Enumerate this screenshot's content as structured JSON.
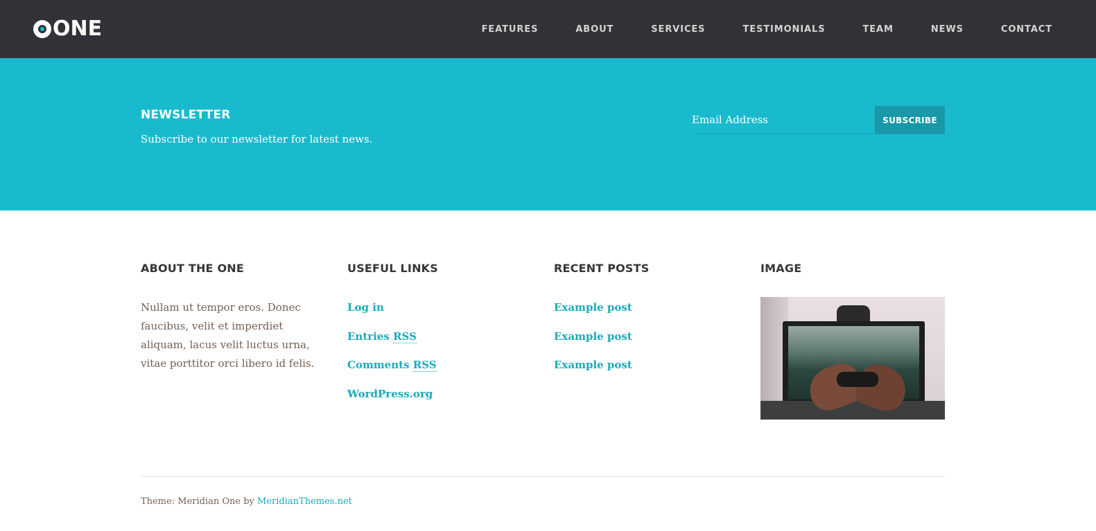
{
  "header": {
    "logo_text": "ONE",
    "nav": [
      "FEATURES",
      "ABOUT",
      "SERVICES",
      "TESTIMONIALS",
      "TEAM",
      "NEWS",
      "CONTACT"
    ]
  },
  "newsletter": {
    "title": "NEWSLETTER",
    "text": "Subscribe to our newsletter for latest news.",
    "email_placeholder": "Email Address",
    "button_label": "SUBSCRIBE"
  },
  "widgets": {
    "about": {
      "title": "ABOUT THE ONE",
      "text": "Nullam ut tempor eros. Donec faucibus, velit et imperdiet aliquam, lacus velit luctus urna, vitae porttitor orci libero id felis."
    },
    "links": {
      "title": "USEFUL LINKS",
      "items": [
        "Log in",
        "Entries",
        "Comments",
        "WordPress.org"
      ],
      "rss": "RSS"
    },
    "posts": {
      "title": "RECENT POSTS",
      "items": [
        "Example post",
        "Example post",
        "Example post"
      ]
    },
    "image": {
      "title": "IMAGE"
    }
  },
  "footer": {
    "credit_prefix": "Theme: Meridian One by ",
    "credit_link": "MeridianThemes.net"
  },
  "colors": {
    "header_bg": "#313235",
    "accent": "#19bacd",
    "button_bg": "#1898a8",
    "link": "#19abbd",
    "body_text": "#735f54"
  }
}
